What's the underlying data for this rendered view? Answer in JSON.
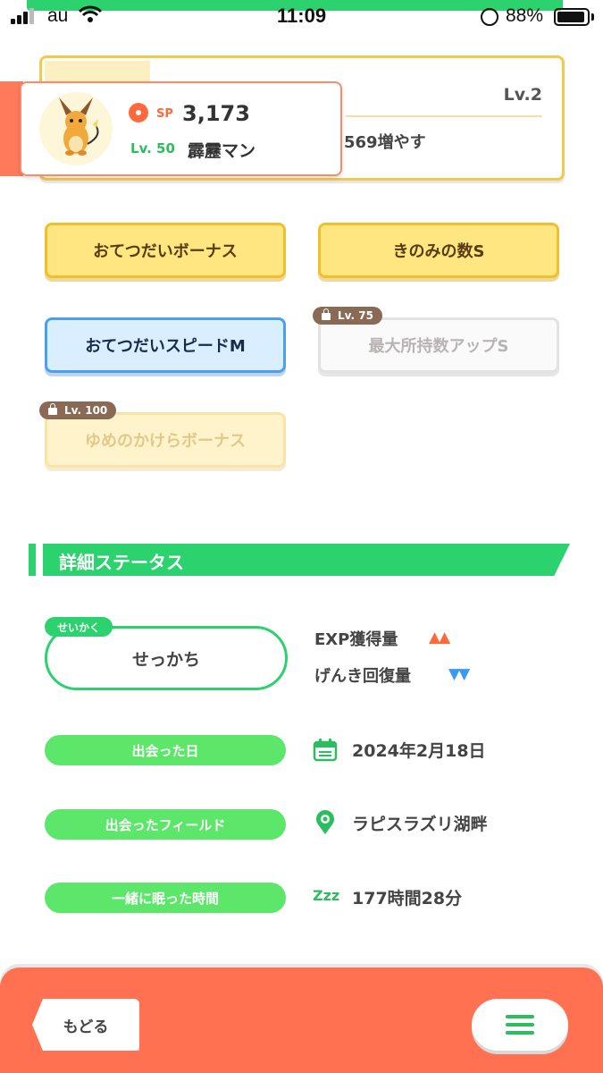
{
  "status_bar": {
    "carrier": "au",
    "time": "11:09",
    "battery_percent": "88%"
  },
  "skill_card": {
    "level": "Lv.2",
    "description_partial": "569増やす"
  },
  "pokemon": {
    "sp_label": "SP",
    "sp_value": "3,173",
    "level": "Lv. 50",
    "nickname": "霹靂マン"
  },
  "sub_skills": [
    {
      "label": "おてつだいボーナス",
      "style": "gold",
      "locked": false
    },
    {
      "label": "きのみの数S",
      "style": "gold",
      "locked": false
    },
    {
      "label": "おてつだいスピードM",
      "style": "blue",
      "locked": false
    },
    {
      "label": "最大所持数アップS",
      "style": "white",
      "locked": true,
      "lock_level": "Lv. 75"
    },
    {
      "label": "ゆめのかけらボーナス",
      "style": "gold",
      "locked": true,
      "lock_level": "Lv. 100"
    }
  ],
  "details": {
    "section_title": "詳細ステータス",
    "nature_tag": "せいかく",
    "nature": "せっかち",
    "nature_up": {
      "label": "EXP獲得量",
      "arrows": "▲▲"
    },
    "nature_down": {
      "label": "げんき回復量",
      "arrows": "▼▼"
    },
    "met_date_label": "出会った日",
    "met_date": "2024年2月18日",
    "met_field_label": "出会ったフィールド",
    "met_field": "ラピスラズリ湖畔",
    "slept_label": "一緒に眠った時間",
    "slept_time": "177時間28分",
    "sleep_icon_text": "Zzz"
  },
  "bottom_bar": {
    "back_label": "もどる"
  },
  "colors": {
    "accent_green": "#2bd26e",
    "pill_green": "#5ce66a",
    "bottom_bar": "#ff7150",
    "gold_border": "#f2bf2c",
    "blue_border": "#4aa0f0"
  }
}
